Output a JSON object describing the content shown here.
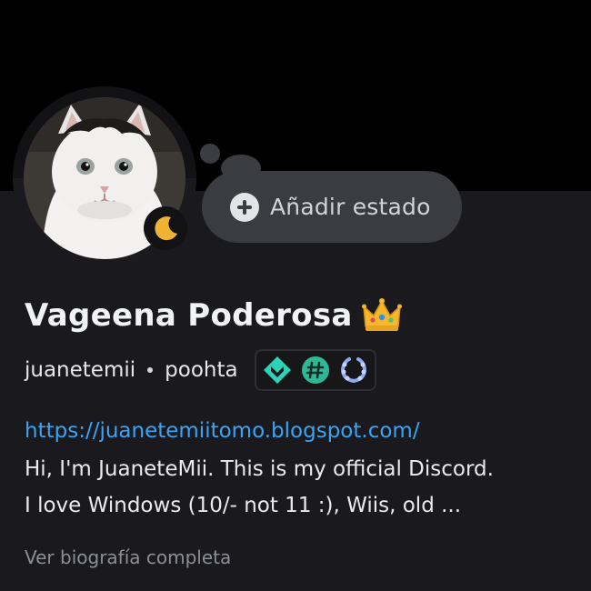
{
  "profile": {
    "display_name": "Vageena Poderosa",
    "name_emoji": "crown-icon",
    "username": "juanetemii",
    "pronouns": "poohta",
    "avatar": "cat-avatar",
    "presence": "idle",
    "badges": [
      "hypesquad-balance-badge",
      "hashtag-badge",
      "laurel-wreath-badge"
    ]
  },
  "status_button": {
    "label": "Añadir estado",
    "icon": "plus-circle-icon"
  },
  "bio": {
    "link": "https://juanetemiitomo.blogspot.com/",
    "line1": "Hi, I'm JuaneteMii. This is my official Discord.",
    "line2": "I love Windows (10/- not 11 :), Wiis, old ..."
  },
  "see_more": "Ver biografía completa",
  "colors": {
    "background": "#1a1a1e",
    "banner": "#000000",
    "link": "#3aa4f4",
    "idle_status": "#f0b232",
    "status_pill": "#3b3c42"
  }
}
